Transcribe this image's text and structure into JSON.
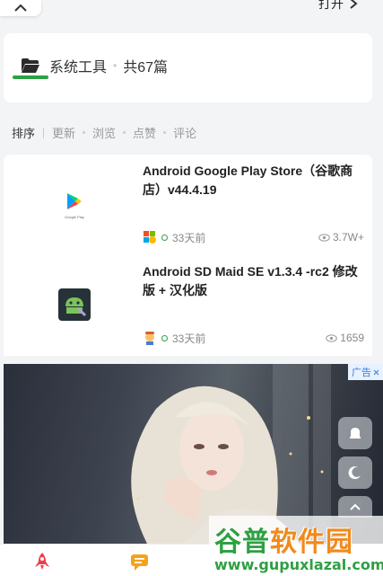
{
  "top": {
    "open_label": "打开"
  },
  "category": {
    "name": "系统工具",
    "count_label": "共67篇",
    "accent_color": "#2ea043"
  },
  "sort": {
    "label": "排序",
    "options": [
      "更新",
      "浏览",
      "点赞",
      "评论"
    ]
  },
  "items": [
    {
      "title": "Android Google Play Store（谷歌商店）v44.4.19",
      "thumb_caption": "Google Play",
      "time": "33天前",
      "views": "3.7W+",
      "icon": "google-play-logo"
    },
    {
      "title": "Android SD Maid SE v1.3.4 -rc2 修改版 + 汉化版",
      "time": "33天前",
      "views": "1659",
      "icon": "sd-maid-logo"
    }
  ],
  "ad": {
    "tag": "广告"
  },
  "watermark": {
    "title_green": "谷普",
    "title_orange": "软件园",
    "url": "www.gupuxlazal.com"
  }
}
